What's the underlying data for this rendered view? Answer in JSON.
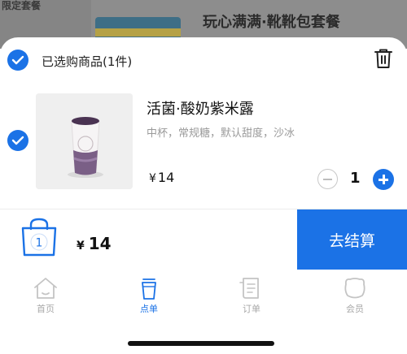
{
  "background": {
    "section_title": "限定套餐",
    "item_title": "玩心满满·靴靴包套餐"
  },
  "cart": {
    "selected_label": "已选购商品(1件)",
    "item": {
      "name": "活菌·酸奶紫米露",
      "spec": "中杯，常规糖，默认甜度，沙冰",
      "price_symbol": "¥",
      "price": "14",
      "quantity": "1"
    }
  },
  "checkout": {
    "bag_count": "1",
    "total_symbol": "¥",
    "total": "14",
    "button_label": "去结算"
  },
  "tabs": [
    {
      "label": "首页",
      "icon": "home-icon",
      "active": false
    },
    {
      "label": "点单",
      "icon": "cup-icon",
      "active": true
    },
    {
      "label": "订单",
      "icon": "order-icon",
      "active": false
    },
    {
      "label": "会员",
      "icon": "member-icon",
      "active": false
    }
  ],
  "colors": {
    "accent": "#1b72e6",
    "muted": "#9a9a9a",
    "overlay": "#8d8d8d"
  }
}
